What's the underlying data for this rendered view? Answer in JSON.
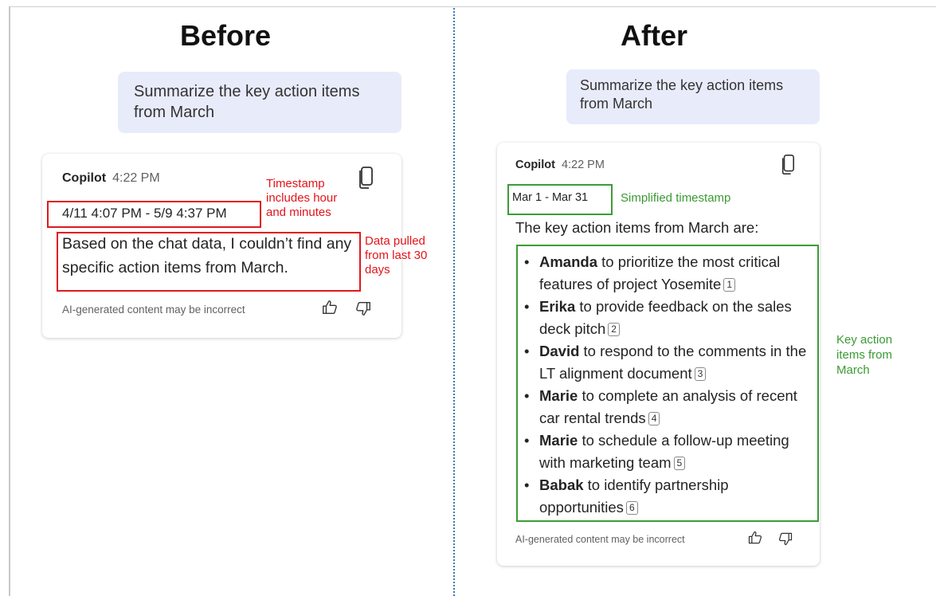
{
  "before": {
    "title": "Before",
    "prompt": "Summarize the key action items from March",
    "card": {
      "sender": "Copilot",
      "time": "4:22 PM",
      "timestamp_range": "4/11 4:07 PM - 5/9 4:37 PM",
      "response": "Based on the chat data, I couldn’t find any specific action items from March.",
      "disclaimer": "AI-generated content may be incorrect",
      "copy_icon": "copy-icon",
      "like_icon": "thumbs-up-icon",
      "dislike_icon": "thumbs-down-icon"
    },
    "notes": {
      "timestamp": "Timestamp includes hour and minutes",
      "data": "Data pulled from last 30 days"
    },
    "highlight_color": "#e0191c"
  },
  "after": {
    "title": "After",
    "prompt": "Summarize the key action items from March",
    "card": {
      "sender": "Copilot",
      "time": "4:22 PM",
      "timestamp_range": "Mar 1 - Mar 31",
      "intro": "The key action items from March are:",
      "items": [
        {
          "name": "Amanda",
          "text": "to prioritize the most critical features of project Yosemite",
          "cite": "1"
        },
        {
          "name": "Erika",
          "text": "to provide feedback on the sales deck pitch",
          "cite": "2"
        },
        {
          "name": "David",
          "text": "to respond to the comments in the LT alignment document",
          "cite": "3"
        },
        {
          "name": "Marie",
          "text": "to complete an analysis of recent car rental trends",
          "cite": "4"
        },
        {
          "name": "Marie",
          "text": "to schedule a follow-up meeting with marketing team",
          "cite": "5"
        },
        {
          "name": "Babak",
          "text": "to identify partnership opportunities",
          "cite": "6"
        }
      ],
      "disclaimer": "AI-generated content may be incorrect",
      "copy_icon": "copy-icon",
      "like_icon": "thumbs-up-icon",
      "dislike_icon": "thumbs-down-icon"
    },
    "notes": {
      "timestamp": "Simplified timestamp",
      "items": "Key action items from March"
    },
    "highlight_color": "#3c9c35"
  }
}
